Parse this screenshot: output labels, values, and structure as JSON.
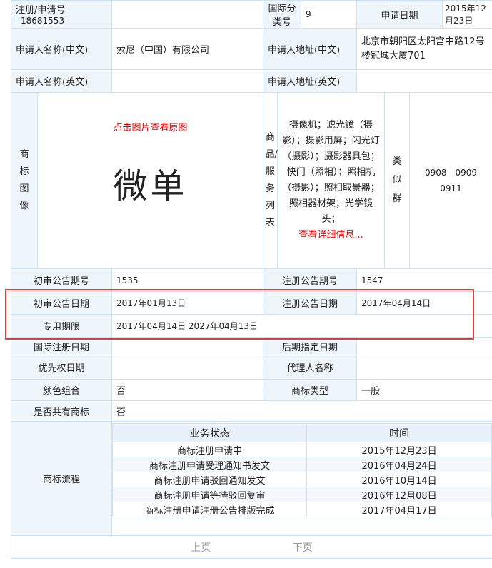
{
  "row1": {
    "reg_no_label": "注册/申请号",
    "reg_no": "18681553",
    "class_label": "国际分类号",
    "class_no": "9",
    "apply_date_label": "申请日期",
    "apply_date": "2015年12月23日"
  },
  "applicant": {
    "name_cn_label": "申请人名称(中文)",
    "name_cn": "索尼（中国）有限公司",
    "addr_cn_label": "申请人地址(中文)",
    "addr_cn": "北京市朝阳区太阳宫中路12号楼冠城大厦701",
    "name_en_label": "申请人名称(英文)",
    "name_en": "",
    "addr_en_label": "申请人地址(英文)",
    "addr_en": ""
  },
  "image": {
    "label": "商标图像",
    "click_hint": "点击图片查看原图",
    "mark_text": "微单"
  },
  "goods": {
    "label": "商品/服务列表",
    "text": "摄像机；滤光镜（摄影）；摄影用屏；闪光灯（摄影）；摄影器具包；快门（照相）；照相机（摄影）；照相取景器；照相器材架；光学镜头；",
    "more_link": "查看详细信息..."
  },
  "similar": {
    "label": "类似群",
    "value": "0908　0909　0911"
  },
  "pub": {
    "prelim_no_label": "初审公告期号",
    "prelim_no": "1535",
    "reg_no_label": "注册公告期号",
    "reg_no": "1547",
    "prelim_date_label": "初审公告日期",
    "prelim_date": "2017年01月13日",
    "reg_date_label": "注册公告日期",
    "reg_date": "2017年04月14日",
    "period_label": "专用期限",
    "period": "2017年04月14日 2027年04月13日"
  },
  "extra": {
    "intl_reg_date_label": "国际注册日期",
    "intl_reg_date": "",
    "later_date_label": "后期指定日期",
    "later_date": "",
    "priority_date_label": "优先权日期",
    "priority_date": "",
    "agent_label": "代理人名称",
    "agent": "",
    "color_label": "颜色组合",
    "color": "否",
    "type_label": "商标类型",
    "type": "一般",
    "shared_label": "是否共有商标",
    "shared": "否"
  },
  "flow": {
    "label": "商标流程",
    "status_header": "业务状态",
    "time_header": "时间",
    "rows": [
      {
        "status": "商标注册申请中",
        "time": "2015年12月23日"
      },
      {
        "status": "商标注册申请受理通知书发文",
        "time": "2016年04月24日"
      },
      {
        "status": "商标注册申请驳回通知发文",
        "time": "2016年10月14日"
      },
      {
        "status": "商标注册申请等待驳回复审",
        "time": "2016年12月08日"
      },
      {
        "status": "商标注册申请注册公告排版完成",
        "time": "2017年04月17日"
      }
    ]
  },
  "pager": {
    "prev": "上页",
    "next": "下页"
  },
  "colors": {
    "highlight_border": "#e03a3a",
    "link_red": "#e00000"
  }
}
